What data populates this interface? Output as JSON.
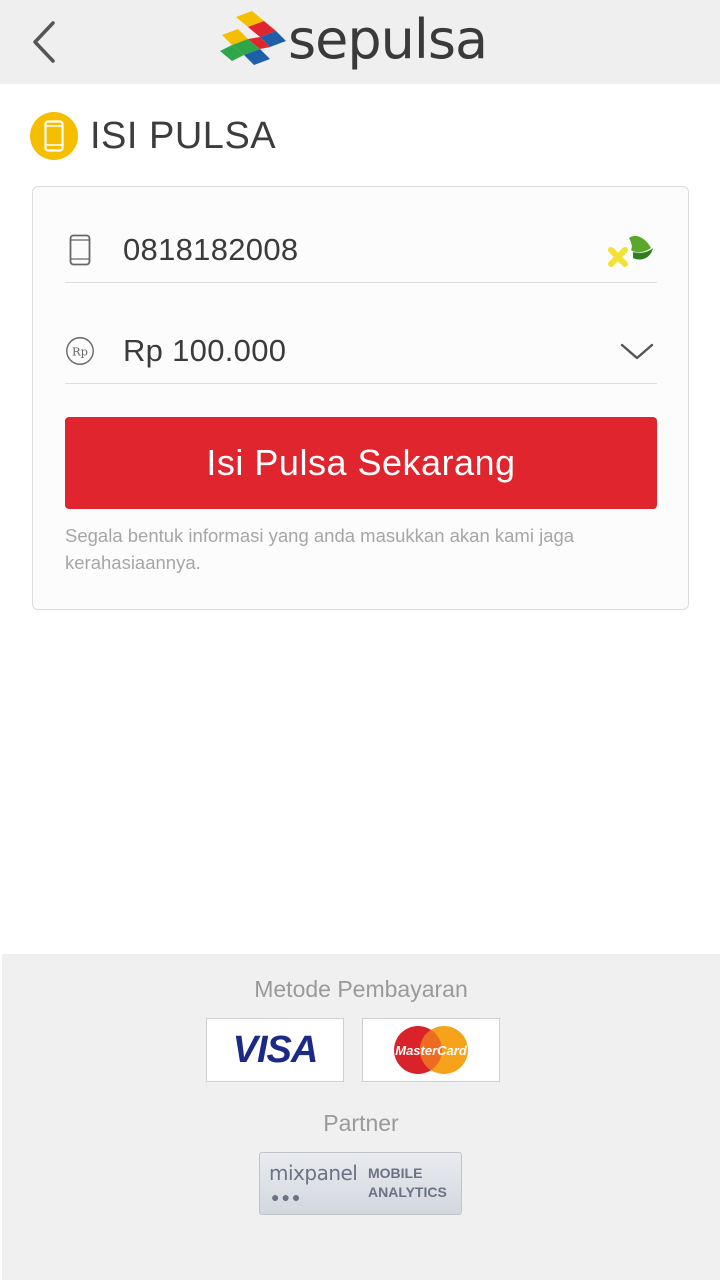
{
  "header": {
    "back_icon": "chevron-left-icon",
    "brand": "sepulsa"
  },
  "section": {
    "icon": "phone-icon",
    "title": "ISI PULSA"
  },
  "form": {
    "phone": {
      "icon": "mobile-phone-icon",
      "value": "0818182008",
      "operator": "xl-operator-logo"
    },
    "amount": {
      "icon": "rupiah-icon",
      "icon_text": "Rp",
      "value": "Rp 100.000",
      "dropdown_icon": "chevron-down-icon"
    },
    "submit_label": "Isi Pulsa Sekarang",
    "note": "Segala bentuk informasi yang anda masukkan akan kami jaga kerahasiaannya."
  },
  "footer": {
    "payment_label": "Metode Pembayaran",
    "payment_methods": [
      {
        "name": "VISA"
      },
      {
        "name": "MasterCard"
      }
    ],
    "partner_label": "Partner",
    "partner": {
      "name": "mixpanel",
      "line1": "MOBILE",
      "line2": "ANALYTICS"
    }
  },
  "colors": {
    "accent_red": "#e0252f",
    "title_icon_yellow": "#f6be00",
    "topbar_bg": "#efefef",
    "footer_bg": "#f0f0f0"
  }
}
